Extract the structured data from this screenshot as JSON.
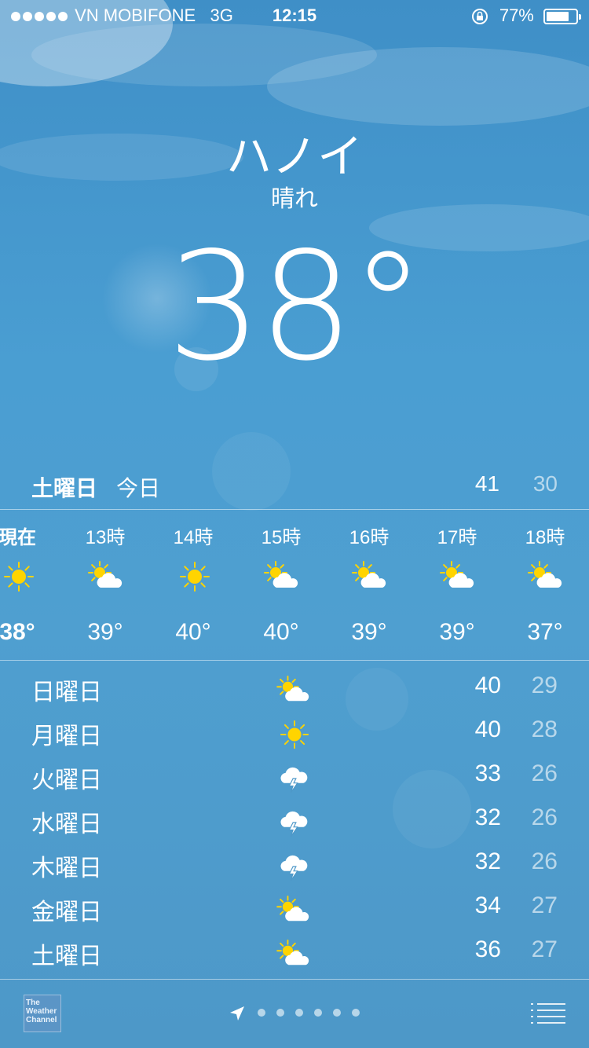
{
  "status_bar": {
    "carrier": "VN MOBIFONE",
    "network": "3G",
    "time": "12:15",
    "battery": "77%",
    "battery_level": 0.77
  },
  "location": {
    "city": "ハノイ",
    "condition": "晴れ",
    "temperature": "38°"
  },
  "today": {
    "day": "土曜日",
    "label": "今日",
    "high": "41",
    "low": "30"
  },
  "hourly": [
    {
      "hour": "現在",
      "icon": "sun-icon",
      "temp": "38°"
    },
    {
      "hour": "13時",
      "icon": "partly-cloudy-icon",
      "temp": "39°"
    },
    {
      "hour": "14時",
      "icon": "sun-icon",
      "temp": "40°"
    },
    {
      "hour": "15時",
      "icon": "partly-cloudy-icon",
      "temp": "40°"
    },
    {
      "hour": "16時",
      "icon": "partly-cloudy-icon",
      "temp": "39°"
    },
    {
      "hour": "17時",
      "icon": "partly-cloudy-icon",
      "temp": "39°"
    },
    {
      "hour": "18時",
      "icon": "partly-cloudy-icon",
      "temp": "37°"
    }
  ],
  "daily": [
    {
      "day": "日曜日",
      "icon": "partly-cloudy-icon",
      "high": "40",
      "low": "29"
    },
    {
      "day": "月曜日",
      "icon": "sun-icon",
      "high": "40",
      "low": "28"
    },
    {
      "day": "火曜日",
      "icon": "thunderstorm-icon",
      "high": "33",
      "low": "26"
    },
    {
      "day": "水曜日",
      "icon": "thunderstorm-icon",
      "high": "32",
      "low": "26"
    },
    {
      "day": "木曜日",
      "icon": "thunderstorm-icon",
      "high": "32",
      "low": "26"
    },
    {
      "day": "金曜日",
      "icon": "partly-cloudy-icon",
      "high": "34",
      "low": "27"
    },
    {
      "day": "土曜日",
      "icon": "partly-cloudy-icon",
      "high": "36",
      "low": "27"
    }
  ],
  "footer": {
    "provider_logo": "The Weather Channel",
    "page_count": 6,
    "current_page": 1
  },
  "colors": {
    "sun": "#ffd400",
    "sky_top": "#3f8fc7",
    "sky_bottom": "#4d98c8"
  }
}
